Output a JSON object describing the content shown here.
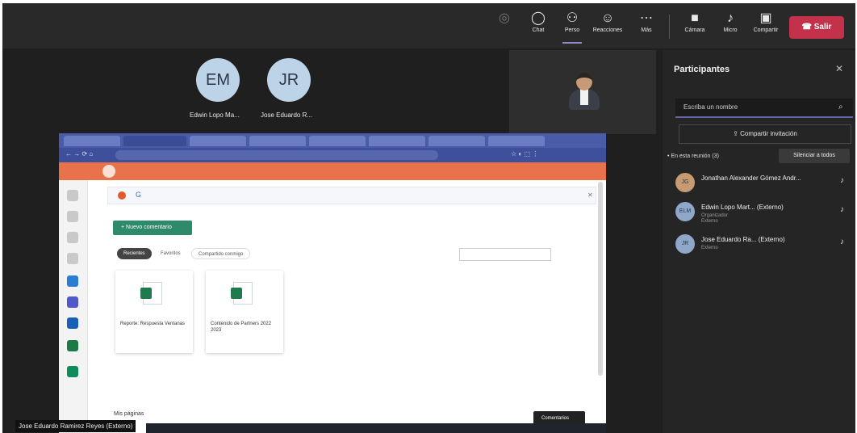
{
  "call": {
    "timer": "",
    "toolbar": [
      {
        "id": "camera-off",
        "label": "",
        "icon": "camera-icon",
        "glyph": "◎",
        "dim": true,
        "active": false
      },
      {
        "id": "chat",
        "label": "Chat",
        "icon": "chat-icon",
        "glyph": "◯",
        "dim": false,
        "active": false
      },
      {
        "id": "people",
        "label": "Perso",
        "icon": "people-icon",
        "glyph": "⚇",
        "dim": false,
        "active": true
      },
      {
        "id": "reactions",
        "label": "Reacciones",
        "icon": "reaction-icon",
        "glyph": "☺",
        "dim": false,
        "active": false
      },
      {
        "id": "more",
        "label": "Más",
        "icon": "more-icon",
        "glyph": "⋯",
        "dim": false,
        "active": false
      }
    ],
    "devices": [
      {
        "id": "camera",
        "label": "Cámara",
        "icon": "video-icon",
        "glyph": "■"
      },
      {
        "id": "mic",
        "label": "Micro",
        "icon": "microphone-icon",
        "glyph": "♪"
      },
      {
        "id": "share",
        "label": "Compartir",
        "icon": "share-screen-icon",
        "glyph": "▣"
      }
    ],
    "leave_label": "Salir"
  },
  "stage": {
    "tiles": [
      {
        "initials": "EM",
        "name": "Edwin Lopo Ma..."
      },
      {
        "initials": "JR",
        "name": "Jose Eduardo R..."
      }
    ]
  },
  "shared": {
    "browser_tabs": [
      "",
      "",
      "",
      "",
      "",
      "",
      "",
      ""
    ],
    "address": "",
    "app_title": "",
    "app_mid": "",
    "banner": "",
    "new_button": "+ Nuevo comentario",
    "filters": [
      "Recientes",
      "Favoritos",
      "Compartido conmigo"
    ],
    "sort": "",
    "docs": [
      {
        "title": "Reporte: Respuesta Ventanas",
        "sub": ""
      },
      {
        "title": "Contenido de Partners 2022 2023",
        "sub": ""
      }
    ],
    "see_more": "",
    "my_pages": "Mis páginas",
    "feedback": "Comentarios",
    "caption": "Jose Eduardo Ramirez Reyes (Externo)"
  },
  "panel": {
    "title": "Participantes",
    "close_glyph": "✕",
    "search_placeholder": "Escriba un nombre",
    "share_invite": "⇪ Compartir invitación",
    "section": "• En esta reunión (3)",
    "mute_all": "Silenciar a todos",
    "participants": [
      {
        "initials": "JG",
        "name": "Jonathan Alexander Gómez Andr...",
        "role": "",
        "role2": "",
        "photo": true
      },
      {
        "initials": "ELM",
        "name": "Edwin Lopo Mart... (Externo)",
        "role": "Organizador",
        "role2": "Externo",
        "photo": false
      },
      {
        "initials": "JR",
        "name": "Jose Eduardo Ra... (Externo)",
        "role": "Externo",
        "role2": "",
        "photo": false
      }
    ]
  }
}
